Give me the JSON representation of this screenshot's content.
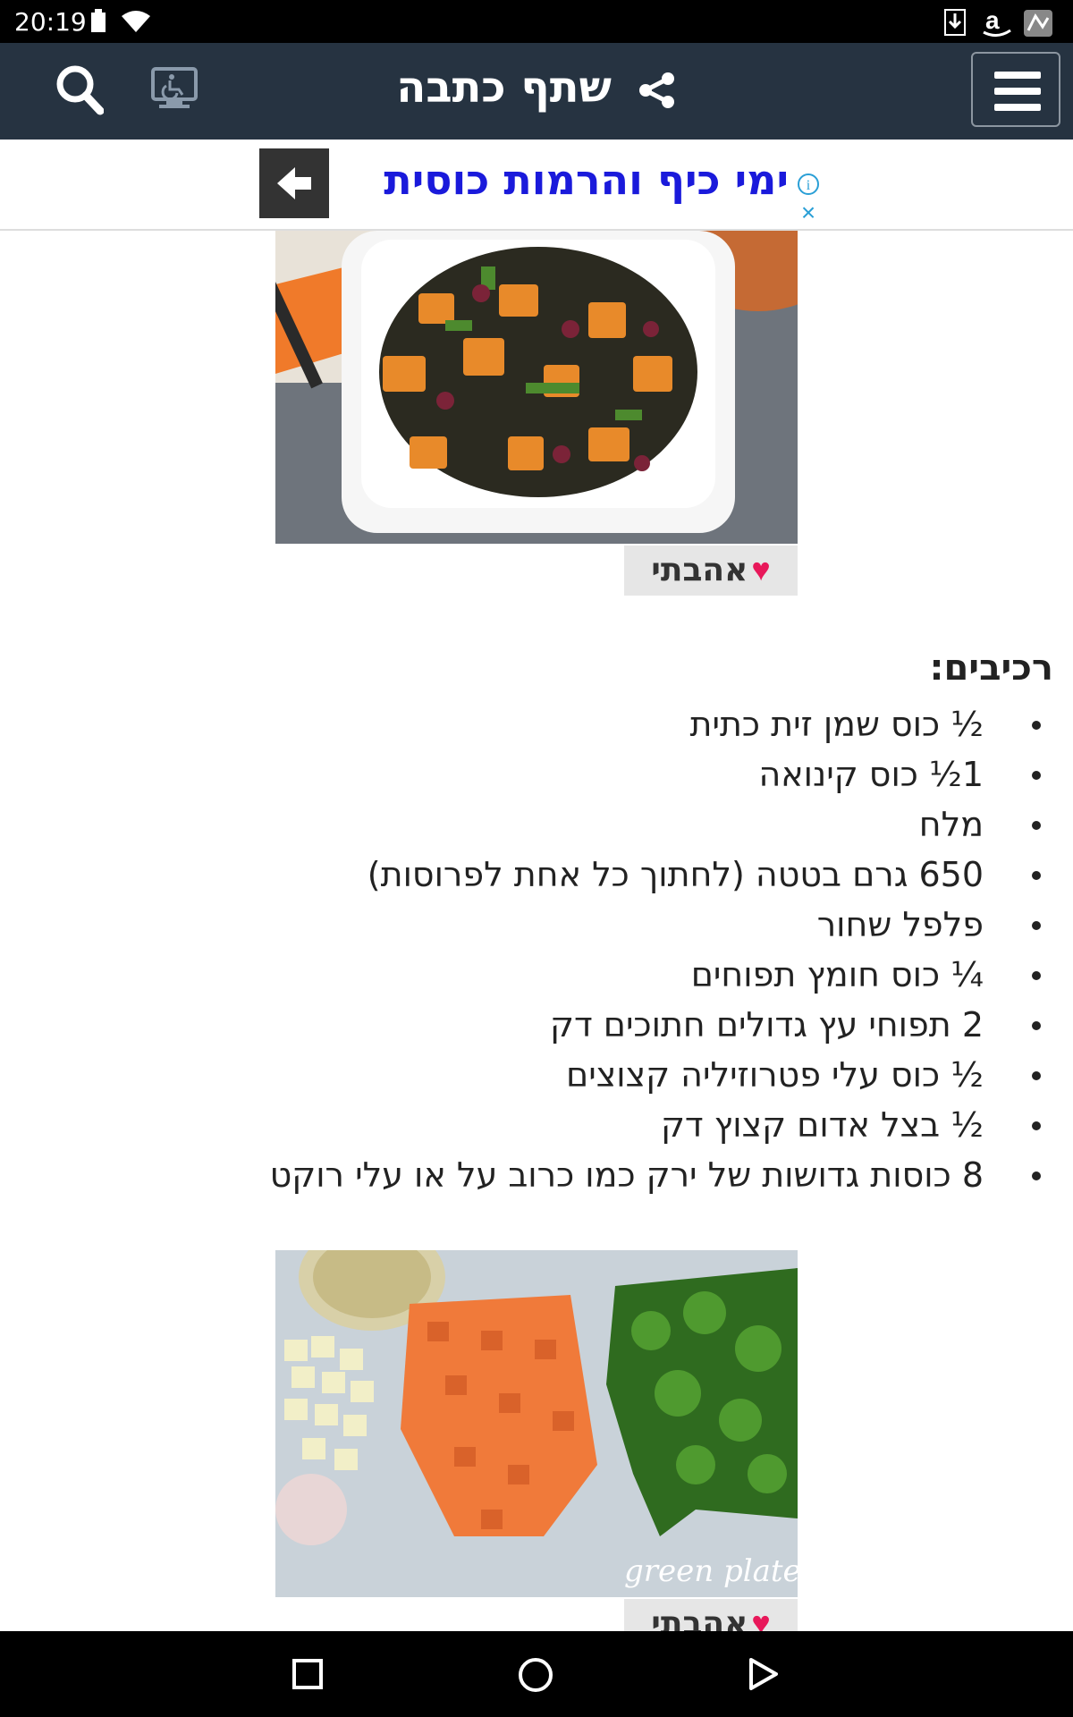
{
  "status_bar": {
    "time": "20:19"
  },
  "header": {
    "title": "שתף כתבה"
  },
  "ad": {
    "text": "ימי כיף והרמות כוסית",
    "info": "i",
    "close": "×"
  },
  "like_button": {
    "label": "אהבתי"
  },
  "ingredients": {
    "title": "רכיבים:",
    "items": [
      "½ כוס שמן זית כתית",
      "1½ כוס קינואה",
      "מלח",
      "650 גרם בטטה (לחתוך כל אחת לפרוסות)",
      "פלפל שחור",
      "¼ כוס חומץ תפוחים",
      "2 תפוחי עץ גדולים חתוכים דק",
      "½ כוס עלי פטרוזיליה קצוצים",
      "½ בצל אדום קצוץ דק",
      "8 כוסות גדושות של ירק כמו כרוב על או עלי רוקט"
    ]
  },
  "photo2": {
    "watermark": "green plate rule"
  },
  "colors": {
    "header_bg": "#263341",
    "ad_text": "#1a1adb",
    "heart": "#e8185a"
  }
}
